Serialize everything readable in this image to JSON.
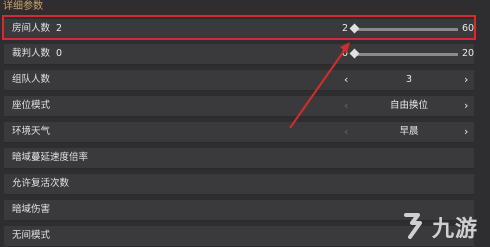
{
  "section_title": "详细参数",
  "rows": [
    {
      "label": "房间人数",
      "value": "2",
      "slider": {
        "min_label": "2",
        "max_label": "60",
        "level": 0.0
      }
    },
    {
      "label": "裁判人数",
      "value": "0",
      "slider": {
        "min_label": "0",
        "max_label": "20",
        "level": 0.0
      }
    },
    {
      "label": "组队人数",
      "selector": {
        "value": "3",
        "left_arrow": "‹",
        "right_arrow": "›"
      }
    },
    {
      "label": "座位模式",
      "selector": {
        "value": "自由换位",
        "left_arrow": "‹",
        "right_arrow": "›"
      }
    },
    {
      "label": "环境天气",
      "selector": {
        "value": "早晨",
        "left_arrow": "‹",
        "right_arrow": "›"
      }
    },
    {
      "label": "暗域蔓延速度倍率"
    },
    {
      "label": "允许复活次数"
    },
    {
      "label": "暗域伤害"
    },
    {
      "label": "无间模式"
    }
  ],
  "watermark": {
    "text": "九游"
  },
  "colors": {
    "highlight": "#d42c2c",
    "section_title": "#c9a46a",
    "row_bg": "#3a3a3d"
  }
}
